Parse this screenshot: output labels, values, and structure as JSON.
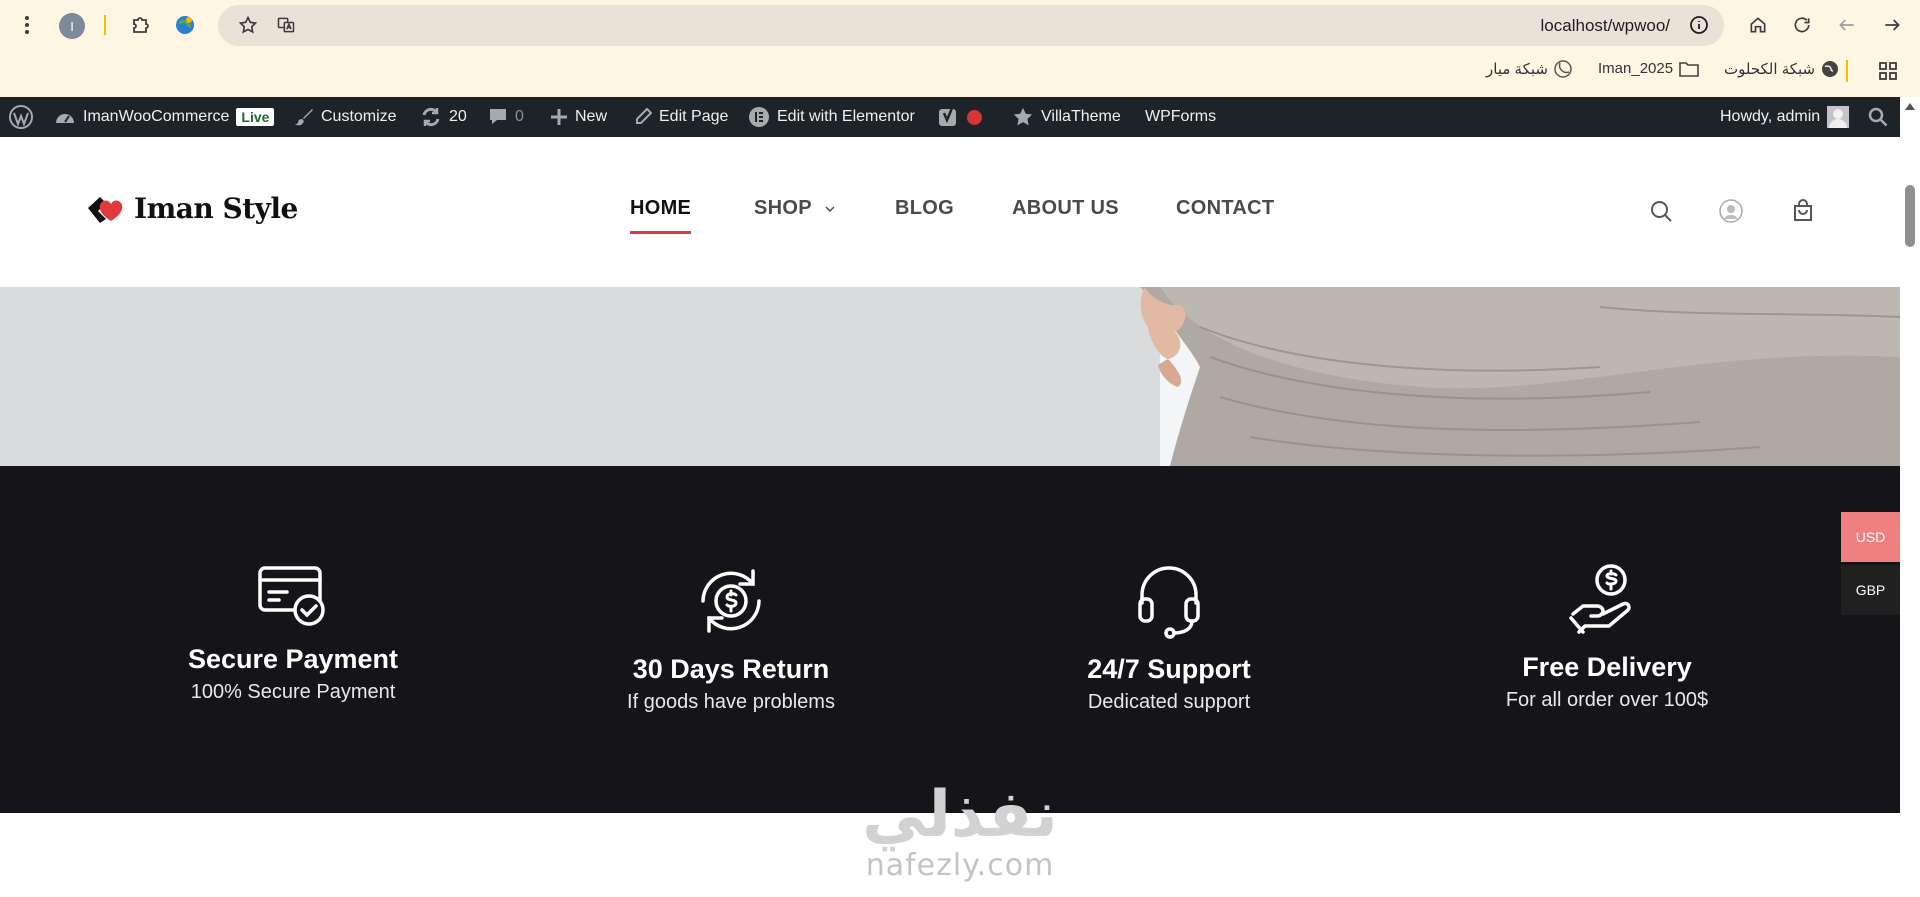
{
  "browser": {
    "url": "localhost/wpwoo/",
    "profile_initial": "I",
    "bookmarks": [
      {
        "label": "شبكة الكحلوت"
      },
      {
        "label": "Iman_2025"
      },
      {
        "label": "شبكة ميار"
      }
    ]
  },
  "admin_bar": {
    "site_name": "ImanWooCommerce",
    "live_badge": "Live",
    "customize": "Customize",
    "updates_count": "20",
    "comments_count": "0",
    "new": "New",
    "edit_page": "Edit Page",
    "edit_elementor": "Edit with Elementor",
    "villatheme": "VillaTheme",
    "wpforms": "WPForms",
    "howdy": "Howdy, admin"
  },
  "header": {
    "logo_text": "Iman Style",
    "nav": [
      {
        "label": "HOME",
        "active": true
      },
      {
        "label": "SHOP",
        "has_dropdown": true
      },
      {
        "label": "BLOG"
      },
      {
        "label": "ABOUT US"
      },
      {
        "label": "CONTACT"
      }
    ]
  },
  "features": [
    {
      "icon": "credit-card-check-icon",
      "title": "Secure Payment",
      "subtitle": "100% Secure Payment"
    },
    {
      "icon": "money-return-icon",
      "title": "30 Days Return",
      "subtitle": "If goods have problems"
    },
    {
      "icon": "headset-support-icon",
      "title": "24/7 Support",
      "subtitle": "Dedicated support"
    },
    {
      "icon": "hand-coin-delivery-icon",
      "title": "Free Delivery",
      "subtitle": "For all order over 100$"
    }
  ],
  "currency": {
    "options": [
      "USD",
      "GBP"
    ],
    "selected": "USD",
    "colors": {
      "USD": "#f08080",
      "GBP": "#202020"
    }
  },
  "watermark": {
    "arabic": "نفذلي",
    "latin": "nafezly.com"
  },
  "colors": {
    "accent": "#e0393e",
    "admin_bar": "#1d2327",
    "features_bg": "#151419",
    "hero_bg": "#dadbdd"
  }
}
